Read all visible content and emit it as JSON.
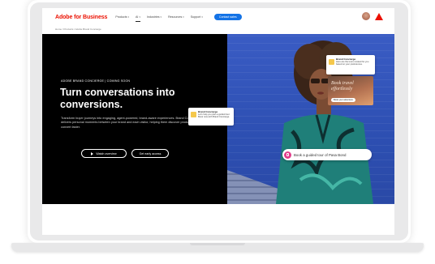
{
  "nav": {
    "logo": "Adobe for Business",
    "items": [
      "Products",
      "AI",
      "Industries",
      "Resources",
      "Support"
    ],
    "active_index": 1,
    "cta": "Contact sales"
  },
  "breadcrumb": "Home  /  Products  /  Adobe Brand Concierge",
  "hero": {
    "eyebrow": "ADOBE BRAND CONCIERGE | COMING SOON",
    "headline": "Turn conversations into conversions.",
    "body": "Transform buyer journeys into engaging, agent-powered, brand-aware experiences. Brand Concierge delivers personal moments between your brand and each visitor, helping them discover products and convert faster.",
    "primary_button": "Watch overview",
    "secondary_button": "Get early access"
  },
  "cards": {
    "small": {
      "title": "Brand Concierge",
      "text": "Let's help you plan a guided tour. Book now with Brand Concierge."
    },
    "top": {
      "title": "Brand Concierge",
      "text": "Here are the tours curated for you based on your preferences."
    },
    "book": {
      "title": "Book travel effortlessly",
      "button": "Book your adventure"
    },
    "pill": "Book a guided tour of Pasa Bond"
  },
  "colors": {
    "brand_red": "#eb1000",
    "cta_blue": "#1473e6",
    "wall_blue": "#3052b8",
    "card_yellow": "#f5c84c",
    "pill_pink": "#e13d8b"
  }
}
